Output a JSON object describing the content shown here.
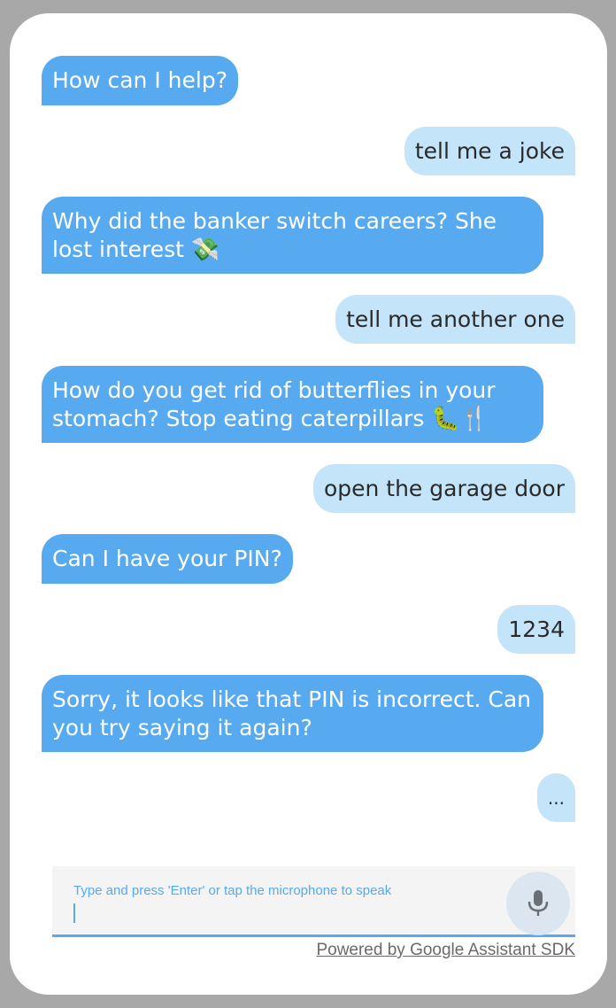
{
  "conversation": [
    {
      "role": "bot",
      "text": "How can I help?",
      "emoji": ""
    },
    {
      "role": "user",
      "text": "tell me a joke",
      "emoji": ""
    },
    {
      "role": "bot",
      "text": "Why did the banker switch careers? She lost interest ",
      "emoji": "💸"
    },
    {
      "role": "user",
      "text": "tell me another one",
      "emoji": ""
    },
    {
      "role": "bot",
      "text": "How do you get rid of butterflies in your stomach? Stop eating caterpillars ",
      "emoji": "🐛🍴"
    },
    {
      "role": "user",
      "text": "open the garage door",
      "emoji": ""
    },
    {
      "role": "bot",
      "text": "Can I have your PIN?",
      "emoji": ""
    },
    {
      "role": "user",
      "text": "1234",
      "emoji": ""
    },
    {
      "role": "bot",
      "text": "Sorry, it looks like that PIN is incorrect. Can you try saying it again?",
      "emoji": ""
    },
    {
      "role": "user",
      "text": "...",
      "emoji": ""
    }
  ],
  "input": {
    "label": "Type and press 'Enter' or tap the microphone to speak",
    "value": "",
    "mic_icon": "microphone-icon"
  },
  "footer": {
    "powered_by": "Powered by Google Assistant SDK"
  },
  "colors": {
    "bot_bubble": "#57a9f0",
    "user_bubble": "#c4e4fa",
    "accent": "#57a9f0"
  }
}
